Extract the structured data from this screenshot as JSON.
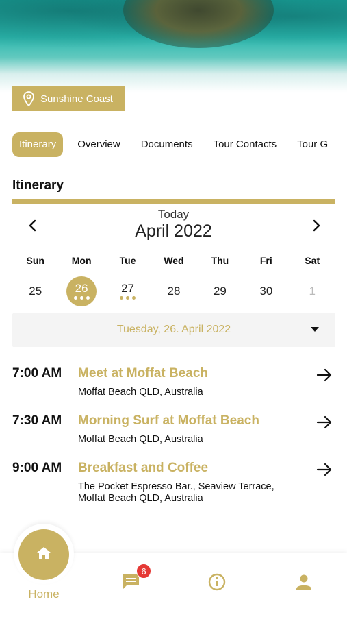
{
  "location": {
    "label": "Sunshine Coast"
  },
  "tabs": [
    {
      "label": "Itinerary",
      "active": true
    },
    {
      "label": "Overview"
    },
    {
      "label": "Documents"
    },
    {
      "label": "Tour Contacts"
    },
    {
      "label": "Tour G"
    }
  ],
  "section": {
    "title": "Itinerary"
  },
  "calendar": {
    "today_label": "Today",
    "month": "April 2022",
    "weekdays": [
      "Sun",
      "Mon",
      "Tue",
      "Wed",
      "Thu",
      "Fri",
      "Sat"
    ],
    "days": [
      "25",
      "26",
      "27",
      "28",
      "29",
      "30",
      "1"
    ],
    "selected_day": "26"
  },
  "date_select": {
    "value": "Tuesday, 26. April 2022"
  },
  "events": [
    {
      "time": "7:00 AM",
      "title": "Meet at Moffat Beach",
      "address": "Moffat Beach QLD, Australia"
    },
    {
      "time": "7:30 AM",
      "title": "Morning Surf at Moffat Beach",
      "address": "Moffat Beach QLD, Australia"
    },
    {
      "time": "9:00 AM",
      "title": "Breakfast and Coffee",
      "address": "The Pocket Espresso Bar., Seaview Terrace, Moffat Beach QLD, Australia"
    }
  ],
  "nav": {
    "home_label": "Home",
    "messages_badge": "6"
  },
  "colors": {
    "accent": "#c9b262",
    "badge": "#e53935"
  }
}
